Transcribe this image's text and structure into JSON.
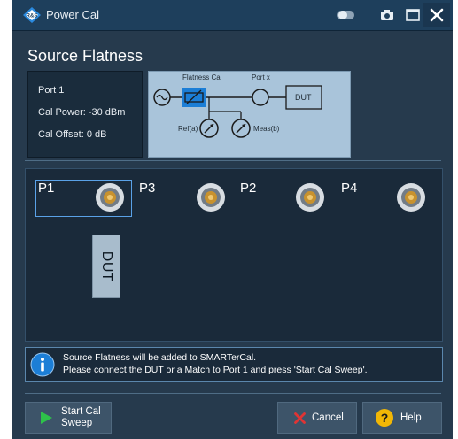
{
  "window": {
    "title": "Power Cal"
  },
  "heading": "Source Flatness",
  "info": {
    "port": "Port 1",
    "cal_power": "Cal Power:  -30 dBm",
    "cal_offset": "Cal Offset:  0 dB"
  },
  "diagram": {
    "flatness_cal": "Flatness Cal",
    "port_x": "Port x",
    "dut": "DUT",
    "ref": "Ref(a)",
    "meas": "Meas(b)"
  },
  "ports": {
    "p1": "P1",
    "p3": "P3",
    "p2": "P2",
    "p4": "P4",
    "dut": "DUT"
  },
  "message": {
    "line1": "Source Flatness will be added to SMARTerCal.",
    "line2": "Please connect the DUT or a Match to Port 1 and press 'Start Cal Sweep'."
  },
  "buttons": {
    "start_line1": "Start Cal",
    "start_line2": "Sweep",
    "cancel": "Cancel",
    "help": "Help"
  },
  "colors": {
    "window_bg": "#263a4d",
    "titlebar_bg": "#1e3f5c",
    "accent_blue": "#1c7ed6",
    "play_green": "#2ec24a",
    "cancel_red": "#e03434",
    "help_yellow": "#f2b705"
  }
}
